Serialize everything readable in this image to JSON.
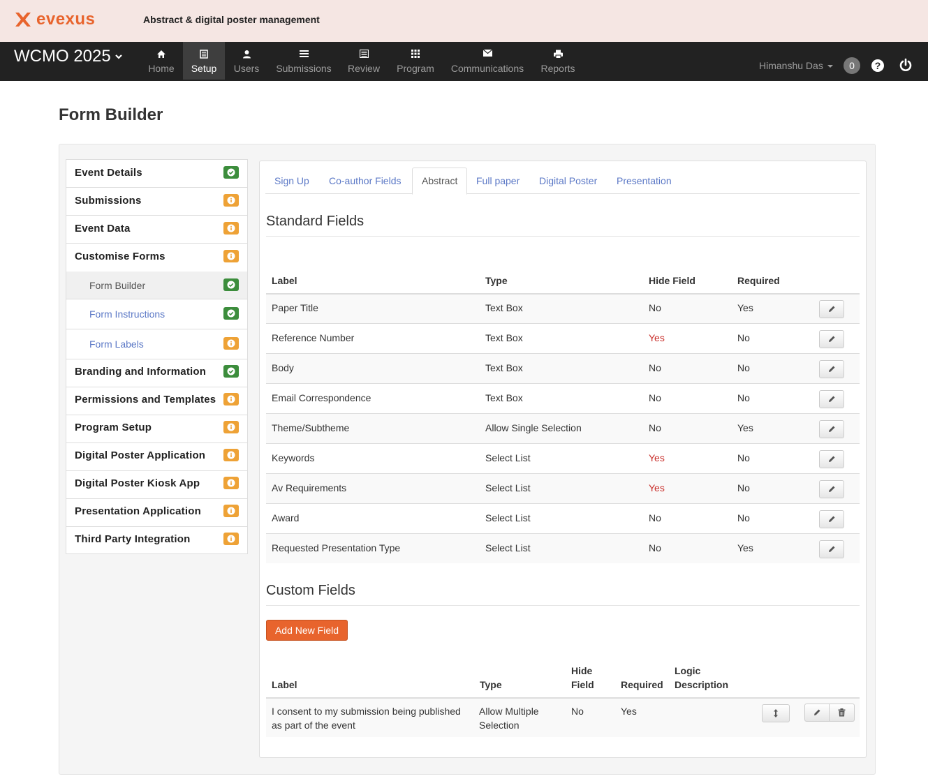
{
  "brand": {
    "logo_text": "evexus",
    "tagline": "Abstract & digital poster management",
    "logo_color": "#e8642d"
  },
  "navbar": {
    "event_title": "WCMO 2025",
    "items": [
      {
        "label": "Home",
        "icon": "home-icon"
      },
      {
        "label": "Setup",
        "icon": "setup-icon",
        "active": true
      },
      {
        "label": "Users",
        "icon": "user-icon"
      },
      {
        "label": "Submissions",
        "icon": "list-icon"
      },
      {
        "label": "Review",
        "icon": "review-icon"
      },
      {
        "label": "Program",
        "icon": "grid-icon"
      },
      {
        "label": "Communications",
        "icon": "envelope-icon"
      },
      {
        "label": "Reports",
        "icon": "print-icon"
      }
    ],
    "user_name": "Himanshu Das",
    "notification_count": "0"
  },
  "page": {
    "title": "Form Builder"
  },
  "sidebar": {
    "items": [
      {
        "label": "Event Details",
        "status": "ok"
      },
      {
        "label": "Submissions",
        "status": "info"
      },
      {
        "label": "Event Data",
        "status": "info"
      },
      {
        "label": "Customise Forms",
        "status": "info"
      },
      {
        "label": "Form Builder",
        "status": "ok",
        "sub": true,
        "current": true
      },
      {
        "label": "Form Instructions",
        "status": "ok",
        "sub": true
      },
      {
        "label": "Form Labels",
        "status": "info",
        "sub": true
      },
      {
        "label": "Branding and Information",
        "status": "ok"
      },
      {
        "label": "Permissions and Templates",
        "status": "info"
      },
      {
        "label": "Program Setup",
        "status": "info"
      },
      {
        "label": "Digital Poster Application",
        "status": "info"
      },
      {
        "label": "Digital Poster Kiosk App",
        "status": "info"
      },
      {
        "label": "Presentation Application",
        "status": "info"
      },
      {
        "label": "Third Party Integration",
        "status": "info"
      }
    ]
  },
  "tabs": [
    {
      "label": "Sign Up"
    },
    {
      "label": "Co-author Fields"
    },
    {
      "label": "Abstract",
      "active": true
    },
    {
      "label": "Full paper"
    },
    {
      "label": "Digital Poster"
    },
    {
      "label": "Presentation"
    }
  ],
  "standard": {
    "title": "Standard Fields",
    "headers": {
      "label": "Label",
      "type": "Type",
      "hide": "Hide Field",
      "required": "Required"
    },
    "rows": [
      {
        "label": "Paper Title",
        "type": "Text Box",
        "hide": "No",
        "required": "Yes"
      },
      {
        "label": "Reference Number",
        "type": "Text Box",
        "hide": "Yes",
        "required": "No"
      },
      {
        "label": "Body",
        "type": "Text Box",
        "hide": "No",
        "required": "No"
      },
      {
        "label": "Email Correspondence",
        "type": "Text Box",
        "hide": "No",
        "required": "No"
      },
      {
        "label": "Theme/Subtheme",
        "type": "Allow Single Selection",
        "hide": "No",
        "required": "Yes"
      },
      {
        "label": "Keywords",
        "type": "Select List",
        "hide": "Yes",
        "required": "No"
      },
      {
        "label": "Av Requirements",
        "type": "Select List",
        "hide": "Yes",
        "required": "No"
      },
      {
        "label": "Award",
        "type": "Select List",
        "hide": "No",
        "required": "No"
      },
      {
        "label": "Requested Presentation Type",
        "type": "Select List",
        "hide": "No",
        "required": "Yes"
      }
    ]
  },
  "custom": {
    "title": "Custom Fields",
    "add_button": "Add New Field",
    "headers": {
      "label": "Label",
      "type": "Type",
      "hide_1": "Hide",
      "hide_2": "Field",
      "required": "Required",
      "logic_1": "Logic",
      "logic_2": "Description"
    },
    "rows": [
      {
        "label_1": "I consent to my submission being published",
        "label_2": "as part of the event",
        "type_1": "Allow Multiple",
        "type_2": "Selection",
        "hide": "No",
        "required": "Yes"
      }
    ]
  },
  "colors": {
    "ok_badge": "#3c8d3c",
    "info_badge": "#eea236",
    "link": "#5b78c6",
    "danger_text": "#c9302c",
    "accent_button": "#e8642d"
  }
}
